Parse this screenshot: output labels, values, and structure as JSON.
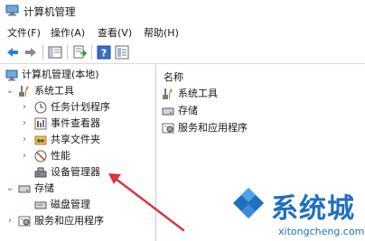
{
  "window": {
    "title": "计算机管理"
  },
  "menu": [
    "文件(F)",
    "操作(A)",
    "查看(V)",
    "帮助(H)"
  ],
  "toolbar": {
    "buttons": [
      "back-arrow-icon",
      "forward-arrow-icon",
      "show-hide-tree-icon",
      "export-list-icon",
      "help-icon",
      "properties-icon"
    ]
  },
  "tree": {
    "root": "计算机管理(本地)",
    "system_tools": "系统工具",
    "task_scheduler": "任务计划程序",
    "event_viewer": "事件查看器",
    "shared_folders": "共享文件夹",
    "performance": "性能",
    "device_manager": "设备管理器",
    "storage": "存储",
    "disk_management": "磁盘管理",
    "services_apps": "服务和应用程序"
  },
  "content": {
    "header": "名称",
    "items": [
      "系统工具",
      "存储",
      "服务和应用程序"
    ]
  },
  "watermark": {
    "text": "系统城",
    "url": "xitongcheng.com"
  },
  "colors": {
    "accent": "#1f6fbf",
    "annotation_arrow": "#d9363e"
  }
}
